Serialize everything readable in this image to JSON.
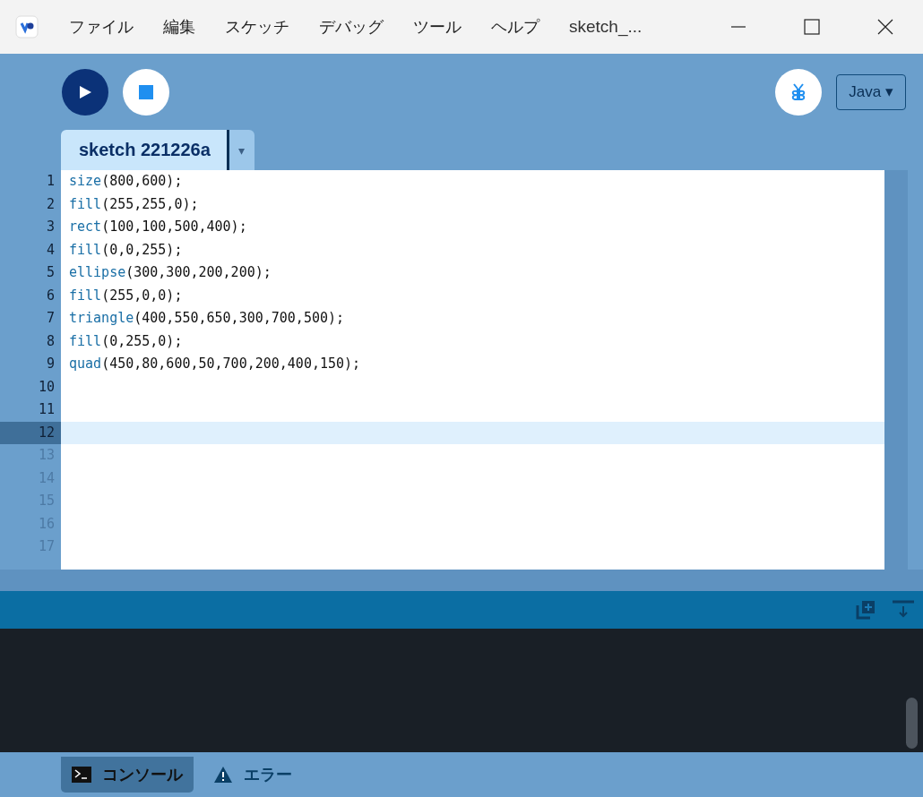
{
  "menu": [
    "ファイル",
    "編集",
    "スケッチ",
    "デバッグ",
    "ツール",
    "ヘルプ"
  ],
  "window": {
    "title": "sketch_..."
  },
  "toolbar": {
    "mode": "Java ▾"
  },
  "tabs": [
    {
      "label": "sketch 221226a",
      "selected": true
    }
  ],
  "tab_menu": "▾",
  "editor": {
    "lines": [
      {
        "number": "1",
        "keyword": "size",
        "rest": "(800,600);",
        "selected": false,
        "dimmed": false
      },
      {
        "number": "2",
        "keyword": "fill",
        "rest": "(255,255,0);",
        "selected": false,
        "dimmed": false
      },
      {
        "number": "3",
        "keyword": "rect",
        "rest": "(100,100,500,400);",
        "selected": false,
        "dimmed": false
      },
      {
        "number": "4",
        "keyword": "fill",
        "rest": "(0,0,255);",
        "selected": false,
        "dimmed": false
      },
      {
        "number": "5",
        "keyword": "ellipse",
        "rest": "(300,300,200,200);",
        "selected": false,
        "dimmed": false
      },
      {
        "number": "6",
        "keyword": "fill",
        "rest": "(255,0,0);",
        "selected": false,
        "dimmed": false
      },
      {
        "number": "7",
        "keyword": "triangle",
        "rest": "(400,550,650,300,700,500);",
        "selected": false,
        "dimmed": false
      },
      {
        "number": "8",
        "keyword": "fill",
        "rest": "(0,255,0);",
        "selected": false,
        "dimmed": false
      },
      {
        "number": "9",
        "keyword": "quad",
        "rest": "(450,80,600,50,700,200,400,150);",
        "selected": false,
        "dimmed": false
      },
      {
        "number": "10",
        "selected": false,
        "dimmed": false
      },
      {
        "number": "11",
        "selected": false,
        "dimmed": false
      },
      {
        "number": "12",
        "selected": true,
        "dimmed": false
      },
      {
        "number": "13",
        "selected": false,
        "dimmed": true
      },
      {
        "number": "14",
        "selected": false,
        "dimmed": true
      },
      {
        "number": "15",
        "selected": false,
        "dimmed": true
      },
      {
        "number": "16",
        "selected": false,
        "dimmed": true
      },
      {
        "number": "17",
        "selected": false,
        "dimmed": true
      }
    ]
  },
  "footer_tabs": [
    {
      "label": "コンソール",
      "kind": "console",
      "selected": true
    },
    {
      "label": "エラー",
      "kind": "errors",
      "selected": false
    }
  ]
}
